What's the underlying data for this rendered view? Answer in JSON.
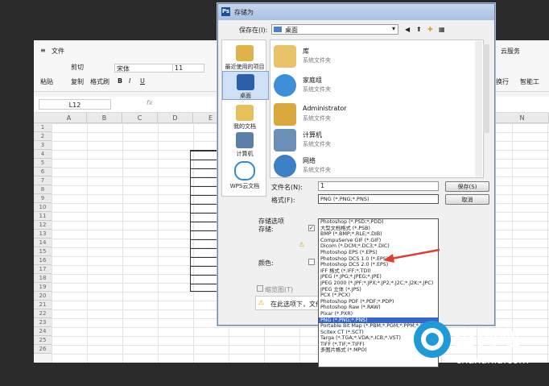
{
  "app": {
    "ribbon_tabs": [
      "文件",
      "云服务"
    ],
    "ribbon": {
      "cut": "剪切",
      "copy": "复制",
      "paste": "粘贴",
      "format_painter": "格式刷",
      "font_name": "宋体",
      "font_size": "11",
      "right_a": "换行",
      "right_b": "智能工",
      "bold": "B",
      "italic": "I",
      "underline": "U"
    },
    "cell_ref": "L12",
    "fx": "fx",
    "columns": [
      "A",
      "B",
      "C",
      "D",
      "E",
      "N"
    ],
    "rows": [
      "1",
      "2",
      "3",
      "4",
      "5",
      "6",
      "7",
      "8",
      "9",
      "10",
      "11",
      "12",
      "13",
      "14",
      "15",
      "16",
      "17",
      "18",
      "19",
      "20",
      "21",
      "22",
      "23",
      "24",
      "25",
      "26"
    ]
  },
  "dialog": {
    "title": "存储为",
    "save_in_label": "保存在(I):",
    "save_in_value": "桌面",
    "places": [
      {
        "label": "最近使用的项目"
      },
      {
        "label": "桌面"
      },
      {
        "label": "我的文档"
      },
      {
        "label": "计算机"
      },
      {
        "label": "WPS云文档"
      }
    ],
    "items": [
      {
        "name": "库",
        "sub": "系统文件夹"
      },
      {
        "name": "家庭组",
        "sub": "系统文件夹"
      },
      {
        "name": "Administrator",
        "sub": "系统文件夹"
      },
      {
        "name": "计算机",
        "sub": "系统文件夹"
      },
      {
        "name": "网络",
        "sub": "系统文件夹"
      }
    ],
    "filename_label": "文件名(N):",
    "filename_value": "1",
    "format_label": "格式(F):",
    "format_value": "PNG (*.PNG;*.PNS)",
    "save_button": "保存(S)",
    "cancel_button": "取消",
    "options_label": "存储选项",
    "store_label": "存储:",
    "color_label": "颜色:",
    "thumbnail_label": "缩览图(T)",
    "info_text": "在此选项下，文件",
    "format_options": [
      "Photoshop (*.PSD;*.PDD)",
      "大型文档格式 (*.PSB)",
      "BMP (*.BMP;*.RLE;*.DIB)",
      "CompuServe GIF (*.GIF)",
      "Dicom (*.DCM;*.DC3;*.DIC)",
      "Photoshop EPS (*.EPS)",
      "Photoshop DCS 1.0 (*.EPS)",
      "Photoshop DCS 2.0 (*.EPS)",
      "IFF 格式 (*.IFF;*.TDI)",
      "JPEG (*.JPG;*.JPEG;*.JPE)",
      "JPEG 2000 (*.JPF;*.JPX;*.JP2;*.J2C;*.J2K;*.JPC)",
      "JPEG 立体 (*.JPS)",
      "PCX (*.PCX)",
      "Photoshop PDF (*.PDF;*.PDP)",
      "Photoshop Raw (*.RAW)",
      "Pixar (*.PXR)",
      "PNG (*.PNG;*.PNS)",
      "Portable Bit Map (*.PBM;*.PGM;*.PPM;*.PNM;*.PFM;*.PAM)",
      "Scitex CT (*.SCT)",
      "Targa (*.TGA;*.VDA;*.ICB;*.VST)",
      "TIFF (*.TIF;*.TIFF)",
      "多图片格式 (*.MPO)"
    ],
    "selected_index": 16
  },
  "watermark": {
    "brand": "查询啦",
    "url": "chaxunla.com"
  },
  "colors": {
    "accent": "#3366cc",
    "arrow": "#e03c31",
    "brand": "#1e9bd7"
  }
}
